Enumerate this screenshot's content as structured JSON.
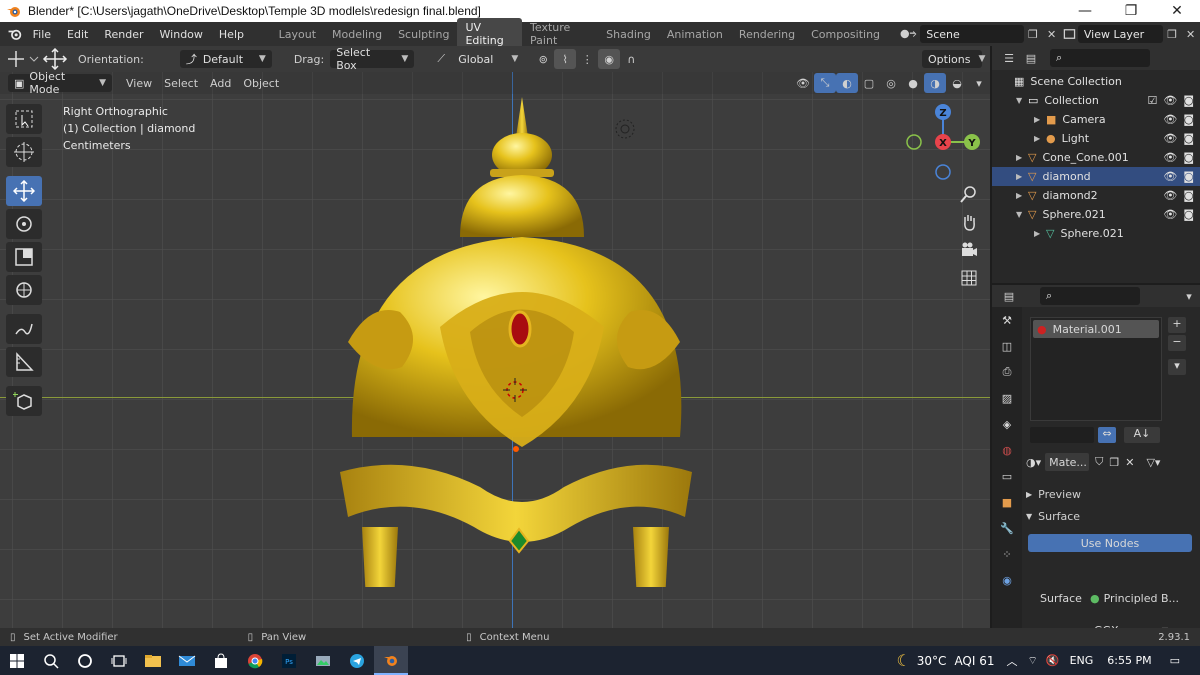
{
  "window": {
    "title": "Blender* [C:\\Users\\jagath\\OneDrive\\Desktop\\Temple 3D modlels\\redesign final.blend]",
    "minimize": "—",
    "maximize": "❐",
    "close": "✕"
  },
  "menu": [
    "File",
    "Edit",
    "Render",
    "Window",
    "Help"
  ],
  "workspaces": [
    "Layout",
    "Modeling",
    "Sculpting",
    "UV Editing",
    "Texture Paint",
    "Shading",
    "Animation",
    "Rendering",
    "Compositing"
  ],
  "active_workspace": "UV Editing",
  "scene": "Scene",
  "view_layer": "View Layer",
  "header": {
    "orientation_label": "Orientation:",
    "orientation_value": "Default",
    "drag_label": "Drag:",
    "drag_value": "Select Box",
    "transform_value": "Global",
    "options": "Options"
  },
  "header2": {
    "mode": "Object Mode",
    "view": "View",
    "select": "Select",
    "add": "Add",
    "object": "Object"
  },
  "viewport": {
    "line1": "Right Orthographic",
    "line2": "(1) Collection | diamond",
    "line3": "Centimeters"
  },
  "gizmo": {
    "z": "Z",
    "y": "Y",
    "x": "X"
  },
  "outliner": {
    "rows": [
      {
        "label": "Scene Collection",
        "indent": 0
      },
      {
        "label": "Collection",
        "indent": 1
      },
      {
        "label": "Camera",
        "indent": 2
      },
      {
        "label": "Light",
        "indent": 2
      },
      {
        "label": "Cone_Cone.001",
        "indent": 1
      },
      {
        "label": "diamond",
        "indent": 1
      },
      {
        "label": "diamond2",
        "indent": 1
      },
      {
        "label": "Sphere.021",
        "indent": 1
      },
      {
        "label": "Sphere.021",
        "indent": 2
      }
    ]
  },
  "properties": {
    "material_slot": "Material.001",
    "material_name": "Mate...",
    "preview": "Preview",
    "surface": "Surface",
    "use_nodes": "Use Nodes",
    "surface_label": "Surface",
    "surface_value": "Principled B...",
    "distribution": "GGX"
  },
  "status": {
    "left": "Set Active Modifier",
    "mid": "Pan View",
    "right": "Context Menu",
    "version": "2.93.1"
  },
  "taskbar": {
    "temperature": "30°C",
    "aqi": "AQI 61",
    "lang": "ENG",
    "time": "6:55 PM"
  },
  "colors": {
    "accent": "#4772b3",
    "gold": "#e0b81a",
    "axis_x": "#e8434b",
    "axis_y": "#8ac24a",
    "axis_z": "#4a84d8"
  }
}
